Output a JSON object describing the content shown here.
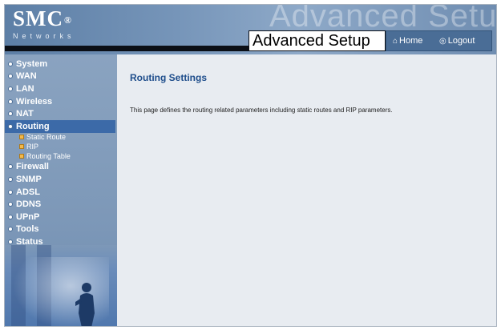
{
  "header": {
    "logo_text": "SMC",
    "logo_reg": "®",
    "logo_sub": "Networks",
    "watermark": "Advanced Setup",
    "title": "Advanced Setup",
    "home_label": "Home",
    "logout_label": "Logout"
  },
  "sidebar": {
    "items": [
      {
        "label": "System"
      },
      {
        "label": "WAN"
      },
      {
        "label": "LAN"
      },
      {
        "label": "Wireless"
      },
      {
        "label": "NAT"
      },
      {
        "label": "Routing",
        "active": true
      },
      {
        "label": "Firewall"
      },
      {
        "label": "SNMP"
      },
      {
        "label": "ADSL"
      },
      {
        "label": "DDNS"
      },
      {
        "label": "UPnP"
      },
      {
        "label": "Tools"
      },
      {
        "label": "Status"
      }
    ],
    "routing_sub": [
      {
        "label": "Static Route"
      },
      {
        "label": "RIP"
      },
      {
        "label": "Routing Table"
      }
    ]
  },
  "main": {
    "title": "Routing Settings",
    "description": "This page defines the routing related parameters including static routes and RIP parameters."
  },
  "colors": {
    "header_blue": "#6f8db1",
    "active_nav": "#3c6aa8",
    "title_blue": "#1f4e8c",
    "content_bg": "#e8ecf1",
    "bullet_orange": "#f2b84a"
  }
}
